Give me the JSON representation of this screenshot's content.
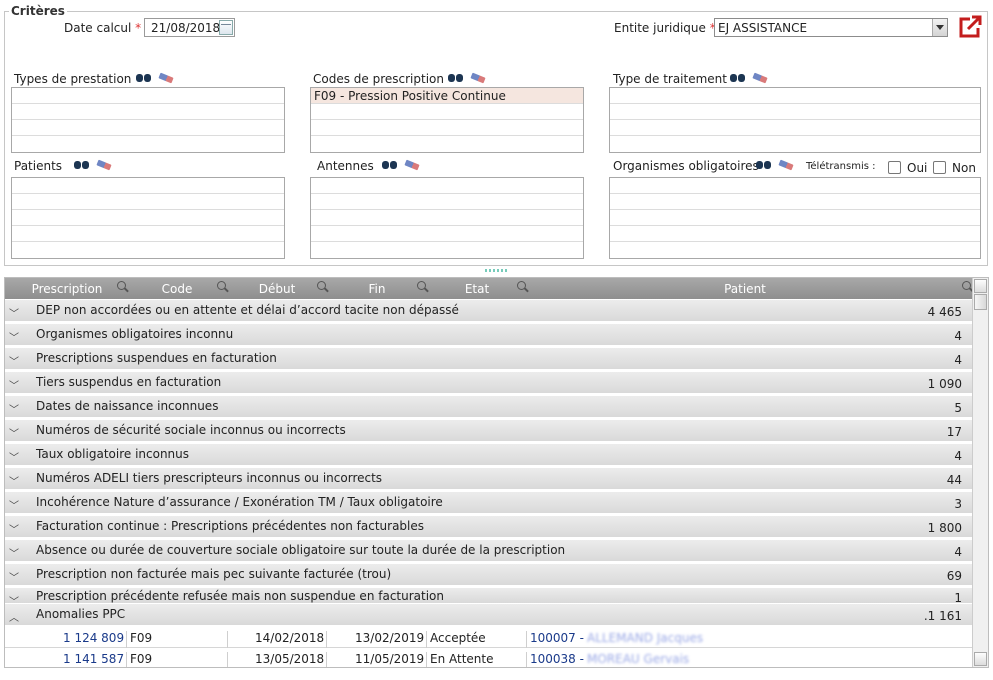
{
  "criteria": {
    "legend": "Critères",
    "date_label": "Date calcul",
    "required_mark": "*",
    "date_value": "21/08/2018",
    "entity_label": "Entite juridique",
    "entity_value": "EJ ASSISTANCE",
    "boxes": {
      "types_prestation": {
        "label": "Types de prestation",
        "items": []
      },
      "codes_prescription": {
        "label": "Codes de prescription",
        "items": [
          "F09 - Pression Positive Continue"
        ]
      },
      "type_traitement": {
        "label": "Type de traitement",
        "items": []
      },
      "patients": {
        "label": "Patients",
        "items": []
      },
      "antennes": {
        "label": "Antennes",
        "items": []
      },
      "organismes": {
        "label": "Organismes obligatoires",
        "items": []
      }
    },
    "teletransmis": {
      "label": "Télétransmis :",
      "oui": "Oui",
      "non": "Non"
    }
  },
  "grid": {
    "columns": [
      "Prescription",
      "Code",
      "Début",
      "Fin",
      "Etat",
      "Patient"
    ],
    "groups": [
      {
        "label": "DEP non accordées ou en attente et délai d’accord tacite non dépassé",
        "count": "4 465"
      },
      {
        "label": "Organismes obligatoires inconnu",
        "count": "4"
      },
      {
        "label": "Prescriptions suspendues en facturation",
        "count": "4"
      },
      {
        "label": "Tiers suspendus en facturation",
        "count": "1 090"
      },
      {
        "label": "Dates de naissance inconnues",
        "count": "5"
      },
      {
        "label": "Numéros de sécurité sociale inconnus ou incorrects",
        "count": "17"
      },
      {
        "label": "Taux obligatoire inconnus",
        "count": "4"
      },
      {
        "label": "Numéros ADELI tiers prescripteurs inconnus ou incorrects",
        "count": "44"
      },
      {
        "label": "Incohérence Nature d’assurance / Exonération TM / Taux obligatoire",
        "count": "3"
      },
      {
        "label": "Facturation continue : Prescriptions précédentes non facturables",
        "count": "1 800"
      },
      {
        "label": "Absence ou durée de couverture sociale obligatoire sur toute la durée de la prescription",
        "count": "4"
      },
      {
        "label": "Prescription non facturée mais pec suivante facturée (trou)",
        "count": "69"
      },
      {
        "label": "Prescription précédente refusée mais non suspendue en facturation",
        "count": "1"
      },
      {
        "label": "Anomalies PPC",
        "count": ".1 161"
      }
    ],
    "rows": [
      {
        "prescription": "1 124 809",
        "code": "F09",
        "debut": "14/02/2018",
        "fin": "13/02/2019",
        "etat": "Acceptée",
        "patient_id": "100007 -",
        "patient_name": "ALLEMAND Jacques"
      },
      {
        "prescription": "1 141 587",
        "code": "F09",
        "debut": "13/05/2018",
        "fin": "11/05/2019",
        "etat": "En Attente",
        "patient_id": "100038 -",
        "patient_name": "MOREAU Gervais"
      }
    ]
  },
  "icons": {
    "search": "binoculars-icon",
    "clear": "eraser-icon",
    "export": "export-icon",
    "filter": "magnifier-icon"
  }
}
